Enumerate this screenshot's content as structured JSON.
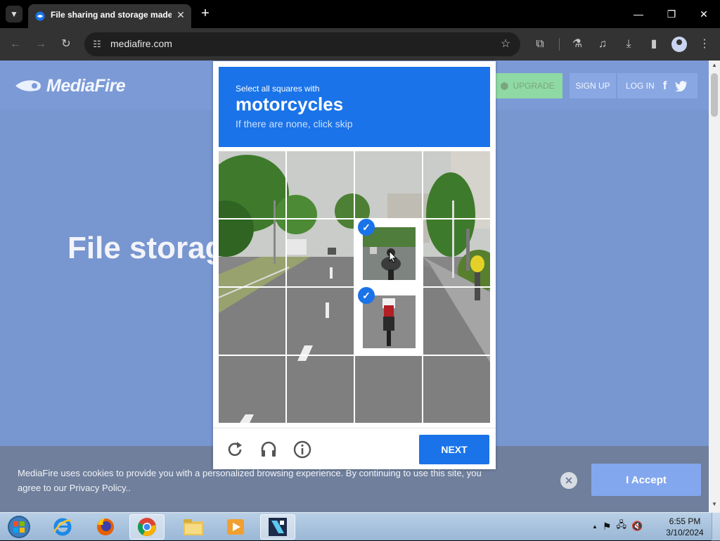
{
  "browser": {
    "tab_title": "File sharing and storage made simple",
    "tab_close": "✕",
    "new_tab": "+",
    "url": "mediafire.com",
    "window_buttons": {
      "minimize": "—",
      "restore": "❐",
      "close": "✕"
    }
  },
  "site": {
    "logo_text": "MediaFire",
    "upgrade_label": "UPGRADE",
    "signup_label": "SIGN UP",
    "login_label": "LOG IN",
    "hero_text": "File storage made simple",
    "cookie_text": "MediaFire uses cookies to provide you with a personalized browsing experience. By continuing to use this site, you agree to our Privacy Policy..",
    "accept_label": "I Accept",
    "cookie_close": "✕"
  },
  "captcha": {
    "instruction": "Select all squares with",
    "target": "motorcycles",
    "hint": "If there are none, click skip",
    "next_label": "NEXT",
    "selected_tiles": [
      "r1c2",
      "r2c2"
    ],
    "check_glyph": "✓",
    "brand_color": "#1a73e8"
  },
  "taskbar": {
    "time": "6:55 PM",
    "date": "3/10/2024",
    "tray_arrow": "▲"
  }
}
